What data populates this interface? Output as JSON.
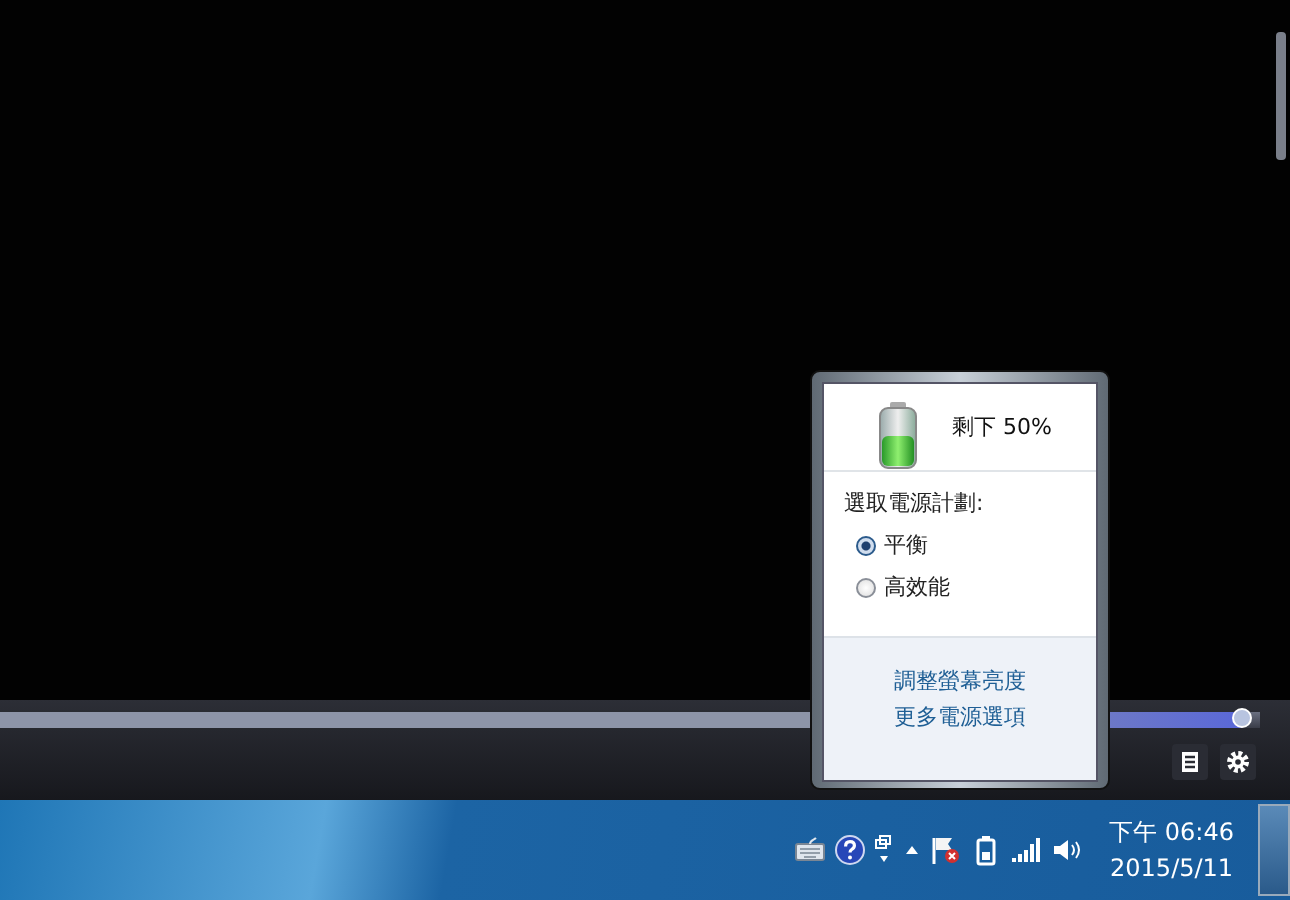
{
  "player": {
    "progress": {
      "level": 0.985
    }
  },
  "power_popup": {
    "status": "剩下 50%",
    "plan_heading": "選取電源計劃:",
    "plans": [
      {
        "label": "平衡",
        "selected": true
      },
      {
        "label": "高效能",
        "selected": false
      }
    ],
    "links": [
      "調整螢幕亮度",
      "更多電源選項"
    ]
  },
  "taskbar": {
    "time": "下午 06:46",
    "date": "2015/5/11"
  }
}
